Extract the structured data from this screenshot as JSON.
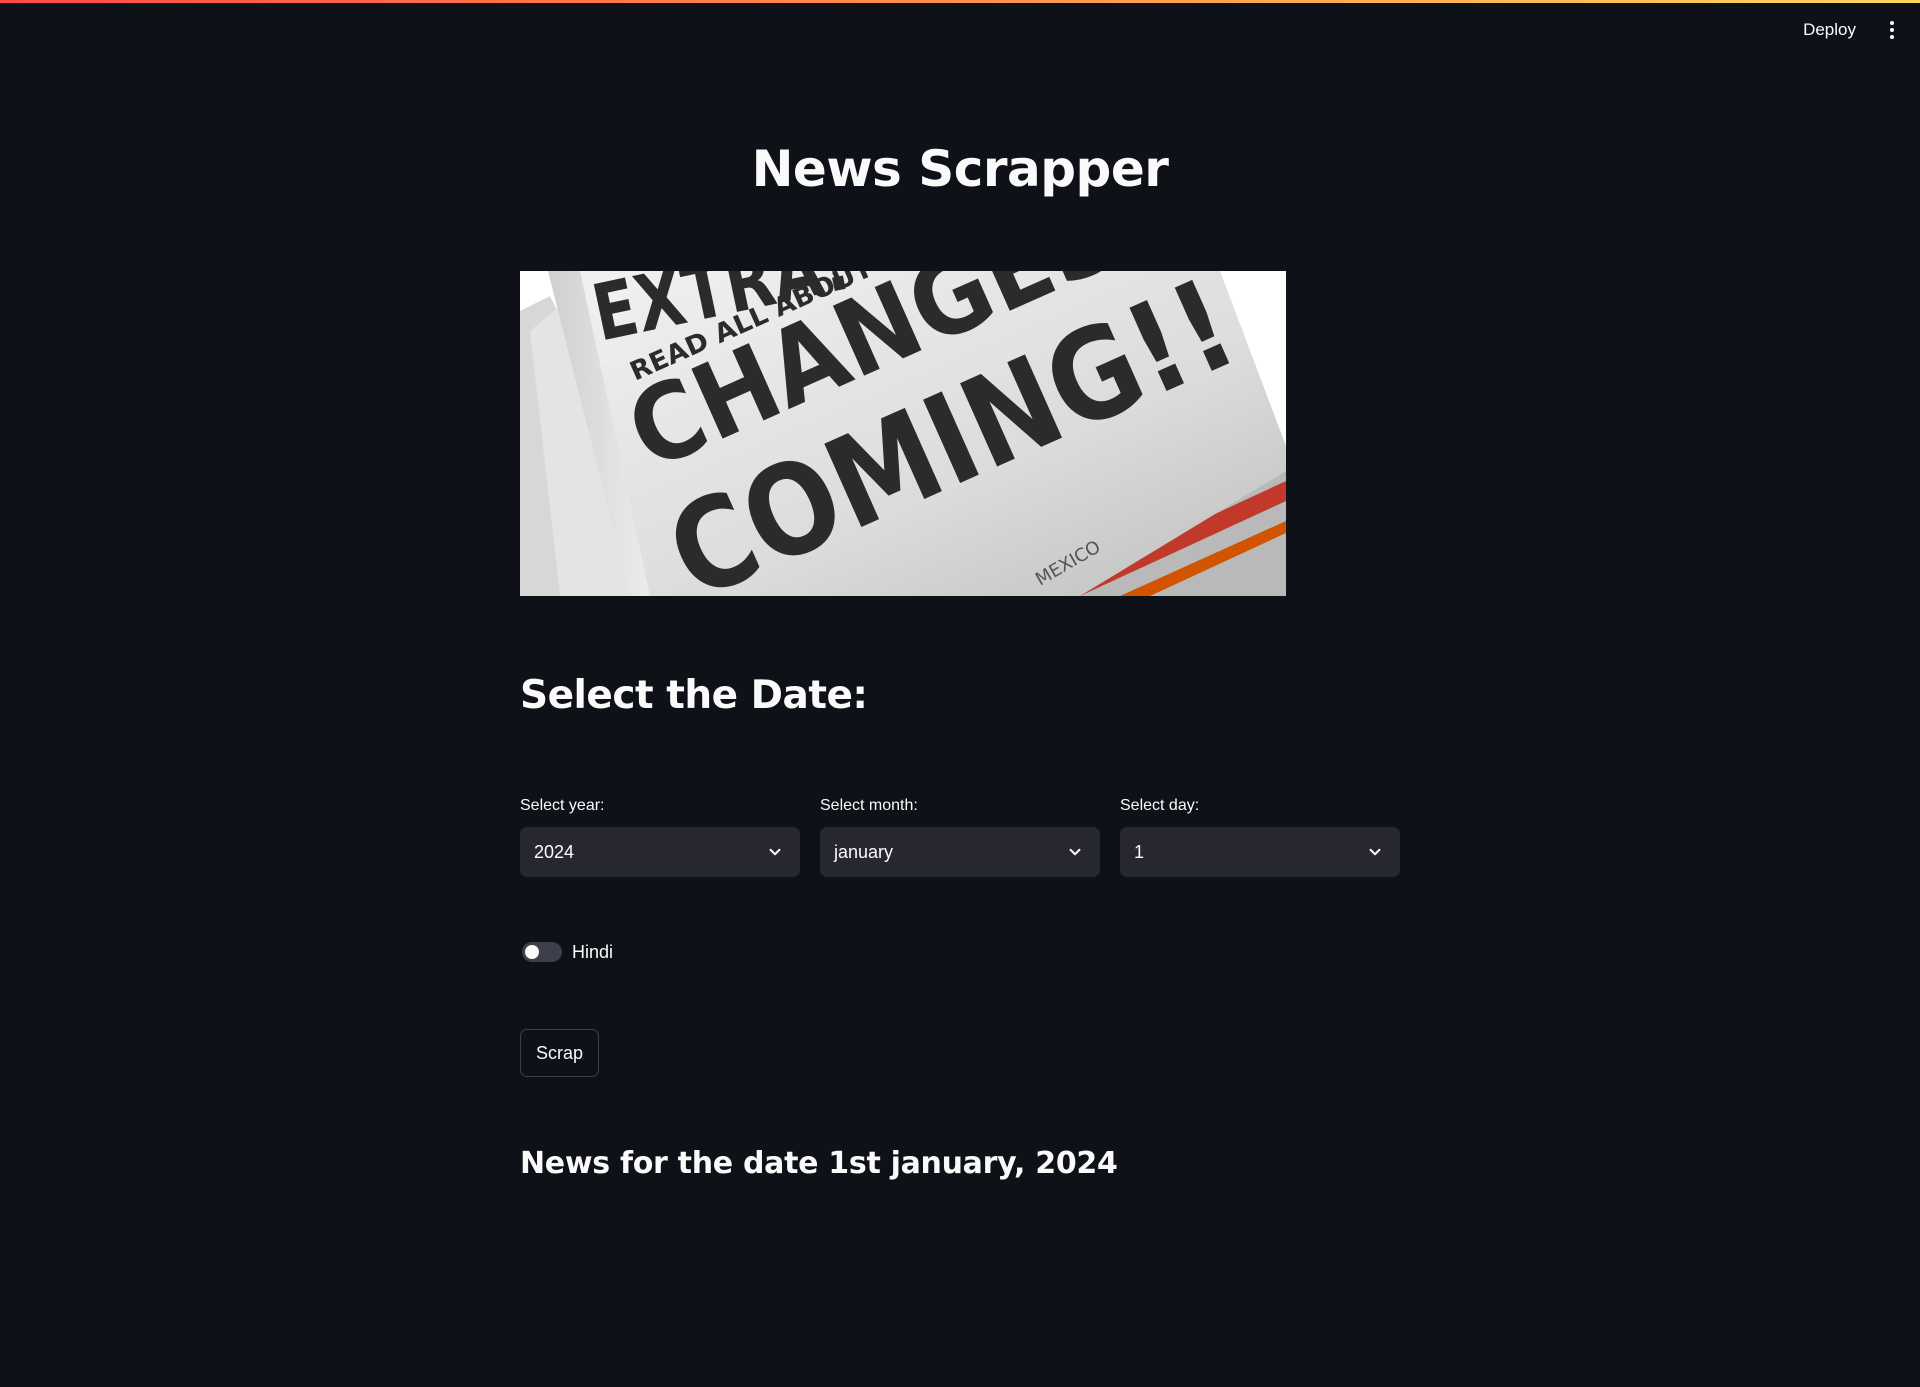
{
  "header": {
    "deploy_label": "Deploy",
    "menu_icon": "vertical-ellipsis-icon"
  },
  "app": {
    "title": "News Scrapper"
  },
  "hero_image": {
    "headline_top": "EXTRA!",
    "tagline": "READ ALL ABOUT IT",
    "headline_main_1": "CHANGES",
    "headline_main_2": "COMING!!",
    "footer_text": "MEXICO"
  },
  "date_section": {
    "heading": "Select the Date:",
    "year": {
      "label": "Select year:",
      "value": "2024"
    },
    "month": {
      "label": "Select month:",
      "value": "january"
    },
    "day": {
      "label": "Select day:",
      "value": "1"
    }
  },
  "toggle": {
    "label": "Hindi",
    "checked": false
  },
  "scrap_button": {
    "label": "Scrap"
  },
  "news": {
    "heading": "News for the date 1st january, 2024"
  },
  "colors": {
    "background": "#0e1117",
    "surface": "#262730",
    "text": "#fafafa",
    "accent_gradient_start": "#ff4b4b",
    "accent_gradient_end": "#fdd85d"
  }
}
